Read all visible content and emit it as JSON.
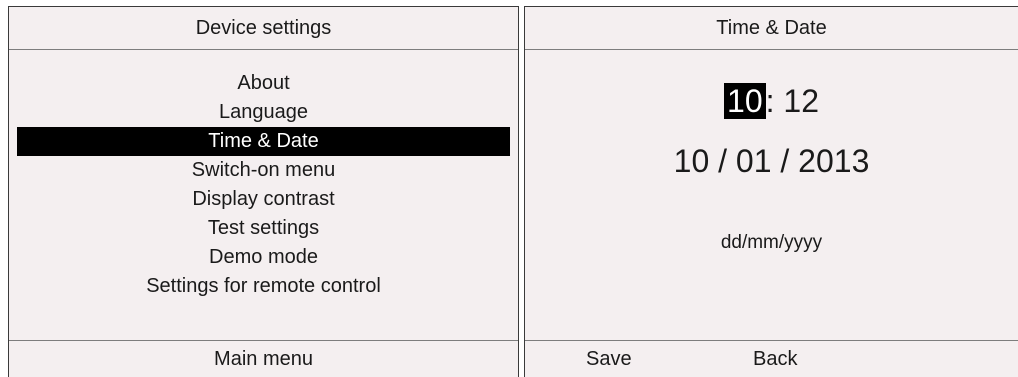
{
  "left_screen": {
    "title": "Device settings",
    "menu_items": [
      {
        "label": "About",
        "selected": false
      },
      {
        "label": "Language",
        "selected": false
      },
      {
        "label": "Time & Date",
        "selected": true
      },
      {
        "label": "Switch-on menu",
        "selected": false
      },
      {
        "label": "Display contrast",
        "selected": false
      },
      {
        "label": "Test settings",
        "selected": false
      },
      {
        "label": "Demo mode",
        "selected": false
      },
      {
        "label": "Settings for remote control",
        "selected": false
      }
    ],
    "footer": "Main menu"
  },
  "right_screen": {
    "title": "Time & Date",
    "time": {
      "hour": "10",
      "separator": ":",
      "minute": "12"
    },
    "date": "10 / 01 / 2013",
    "date_format": "dd/mm/yyyy",
    "footer": {
      "save_label": "Save",
      "back_label": "Back"
    }
  },
  "colors": {
    "screen_bg": "#f4eff0",
    "highlight_bg": "#000000",
    "highlight_fg": "#ffffff",
    "text": "#1a1a1a"
  }
}
